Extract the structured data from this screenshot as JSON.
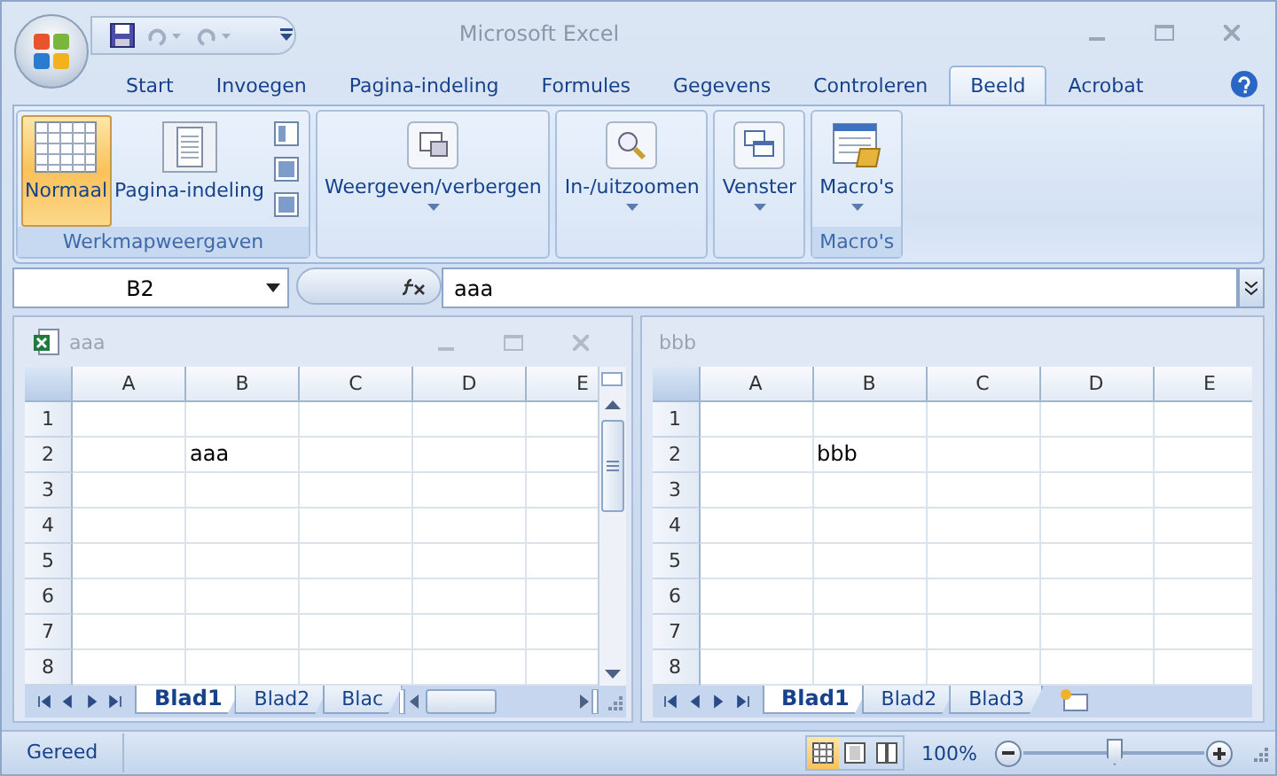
{
  "window": {
    "title": "Microsoft Excel"
  },
  "tabs": [
    {
      "label": "Start",
      "selected": false
    },
    {
      "label": "Invoegen",
      "selected": false
    },
    {
      "label": "Pagina-indeling",
      "selected": false
    },
    {
      "label": "Formules",
      "selected": false
    },
    {
      "label": "Gegevens",
      "selected": false
    },
    {
      "label": "Controleren",
      "selected": false
    },
    {
      "label": "Beeld",
      "selected": true
    },
    {
      "label": "Acrobat",
      "selected": false
    }
  ],
  "ribbon": {
    "groups": [
      {
        "label": "Werkmapweergaven",
        "buttons": [
          {
            "kind": "grid",
            "label": "Normaal",
            "selected": true
          },
          {
            "kind": "page",
            "label": "Pagina-indeling",
            "selected": false
          },
          {
            "kind": "small",
            "selected": false
          }
        ]
      },
      {
        "buttons": [
          {
            "kind": "show",
            "label": "Weergeven/verbergen",
            "dropdown": true,
            "selected": false
          }
        ]
      },
      {
        "buttons": [
          {
            "kind": "zoom",
            "label": "In-/uitzoomen",
            "dropdown": true,
            "selected": false
          }
        ]
      },
      {
        "buttons": [
          {
            "kind": "window",
            "label": "Venster",
            "dropdown": true,
            "selected": false
          }
        ]
      },
      {
        "label": "Macro's",
        "buttons": [
          {
            "kind": "macro",
            "label": "Macro's",
            "dropdown": true,
            "selected": false
          }
        ]
      }
    ]
  },
  "formula_bar": {
    "name_box": "B2",
    "formula": "aaa"
  },
  "workbooks": [
    {
      "title": "aaa",
      "active": true,
      "columns": [
        "A",
        "B",
        "C",
        "D",
        "E"
      ],
      "rows": [
        {
          "label": "1"
        },
        {
          "label": "2",
          "cells": [
            null,
            "aaa",
            null,
            null,
            null
          ]
        },
        {
          "label": "3"
        },
        {
          "label": "4"
        },
        {
          "label": "5"
        },
        {
          "label": "6"
        },
        {
          "label": "7"
        },
        {
          "label": "8"
        }
      ],
      "sheets": [
        {
          "label": "Blad1",
          "selected": true
        },
        {
          "label": "Blad2",
          "selected": false
        },
        {
          "label": "Blac",
          "selected": false
        }
      ]
    },
    {
      "title": "bbb",
      "active": false,
      "columns": [
        "A",
        "B",
        "C",
        "D",
        "E"
      ],
      "rows": [
        {
          "label": "1"
        },
        {
          "label": "2",
          "cells": [
            null,
            "bbb",
            null,
            null,
            null
          ]
        },
        {
          "label": "3"
        },
        {
          "label": "4"
        },
        {
          "label": "5"
        },
        {
          "label": "6"
        },
        {
          "label": "7"
        },
        {
          "label": "8"
        }
      ],
      "sheets": [
        {
          "label": "Blad1",
          "selected": true
        },
        {
          "label": "Blad2",
          "selected": false
        },
        {
          "label": "Blad3",
          "selected": false
        }
      ]
    }
  ],
  "status_bar": {
    "text": "Gereed",
    "views": [
      {
        "kind": "normal",
        "selected": true
      },
      {
        "kind": "page",
        "selected": false
      },
      {
        "kind": "break",
        "selected": false
      }
    ],
    "zoom": "100%",
    "zoom_slider": {
      "level": 0.5
    }
  }
}
